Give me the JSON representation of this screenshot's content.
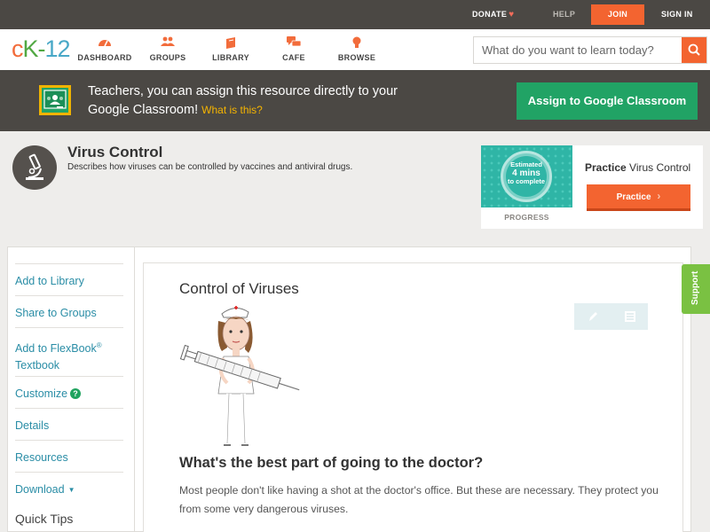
{
  "topbar": {
    "donate": "DONATE",
    "help": "HELP",
    "join": "JOIN",
    "signin": "SIGN IN"
  },
  "logo": {
    "c": "c",
    "k": "K-",
    "n": "12"
  },
  "nav": {
    "dashboard": "DASHBOARD",
    "groups": "GROUPS",
    "library": "LIBRARY",
    "cafe": "CAFE",
    "browse": "BROWSE"
  },
  "search": {
    "placeholder": "What do you want to learn today?"
  },
  "banner": {
    "text": "Teachers, you can assign this resource directly to your Google Classroom!",
    "whatis": "What is this?",
    "assign": "Assign to Google Classroom"
  },
  "concept": {
    "title": "Virus Control",
    "description": "Describes how viruses can be controlled by vaccines and antiviral drugs."
  },
  "practice": {
    "estimated": "Estimated",
    "mins": "4 mins",
    "complete": "to complete",
    "progress_label": "PROGRESS",
    "title_bold": "Practice",
    "title_rest": "Virus Control",
    "button": "Practice"
  },
  "sidebar": {
    "add_library": "Add to Library",
    "share_groups": "Share to Groups",
    "add_flexbook": "Add to FlexBook",
    "add_flexbook_reg": "®",
    "add_flexbook_2": "Textbook",
    "customize": "Customize",
    "customize_help": "?",
    "details": "Details",
    "resources": "Resources",
    "download": "Download",
    "quicktips": "Quick Tips"
  },
  "content": {
    "section_title": "Control of Viruses",
    "question": "What's the best part of going to the doctor?",
    "paragraph": "Most people don't like having a shot at the doctor's office. But these are necessary. They protect you from some very dangerous viruses."
  },
  "support": "Support",
  "colors": {
    "brand_orange": "#f36430",
    "classroom_green": "#21a365",
    "link_teal": "#2a8da6",
    "dark_bar": "#4b4844",
    "support_green": "#7ac142"
  },
  "icons": {
    "heart": "heart-icon",
    "search": "search-icon",
    "microscope": "microscope-icon",
    "pencil": "pencil-icon",
    "notes": "notes-icon",
    "chevron": "chevron-right-icon"
  }
}
